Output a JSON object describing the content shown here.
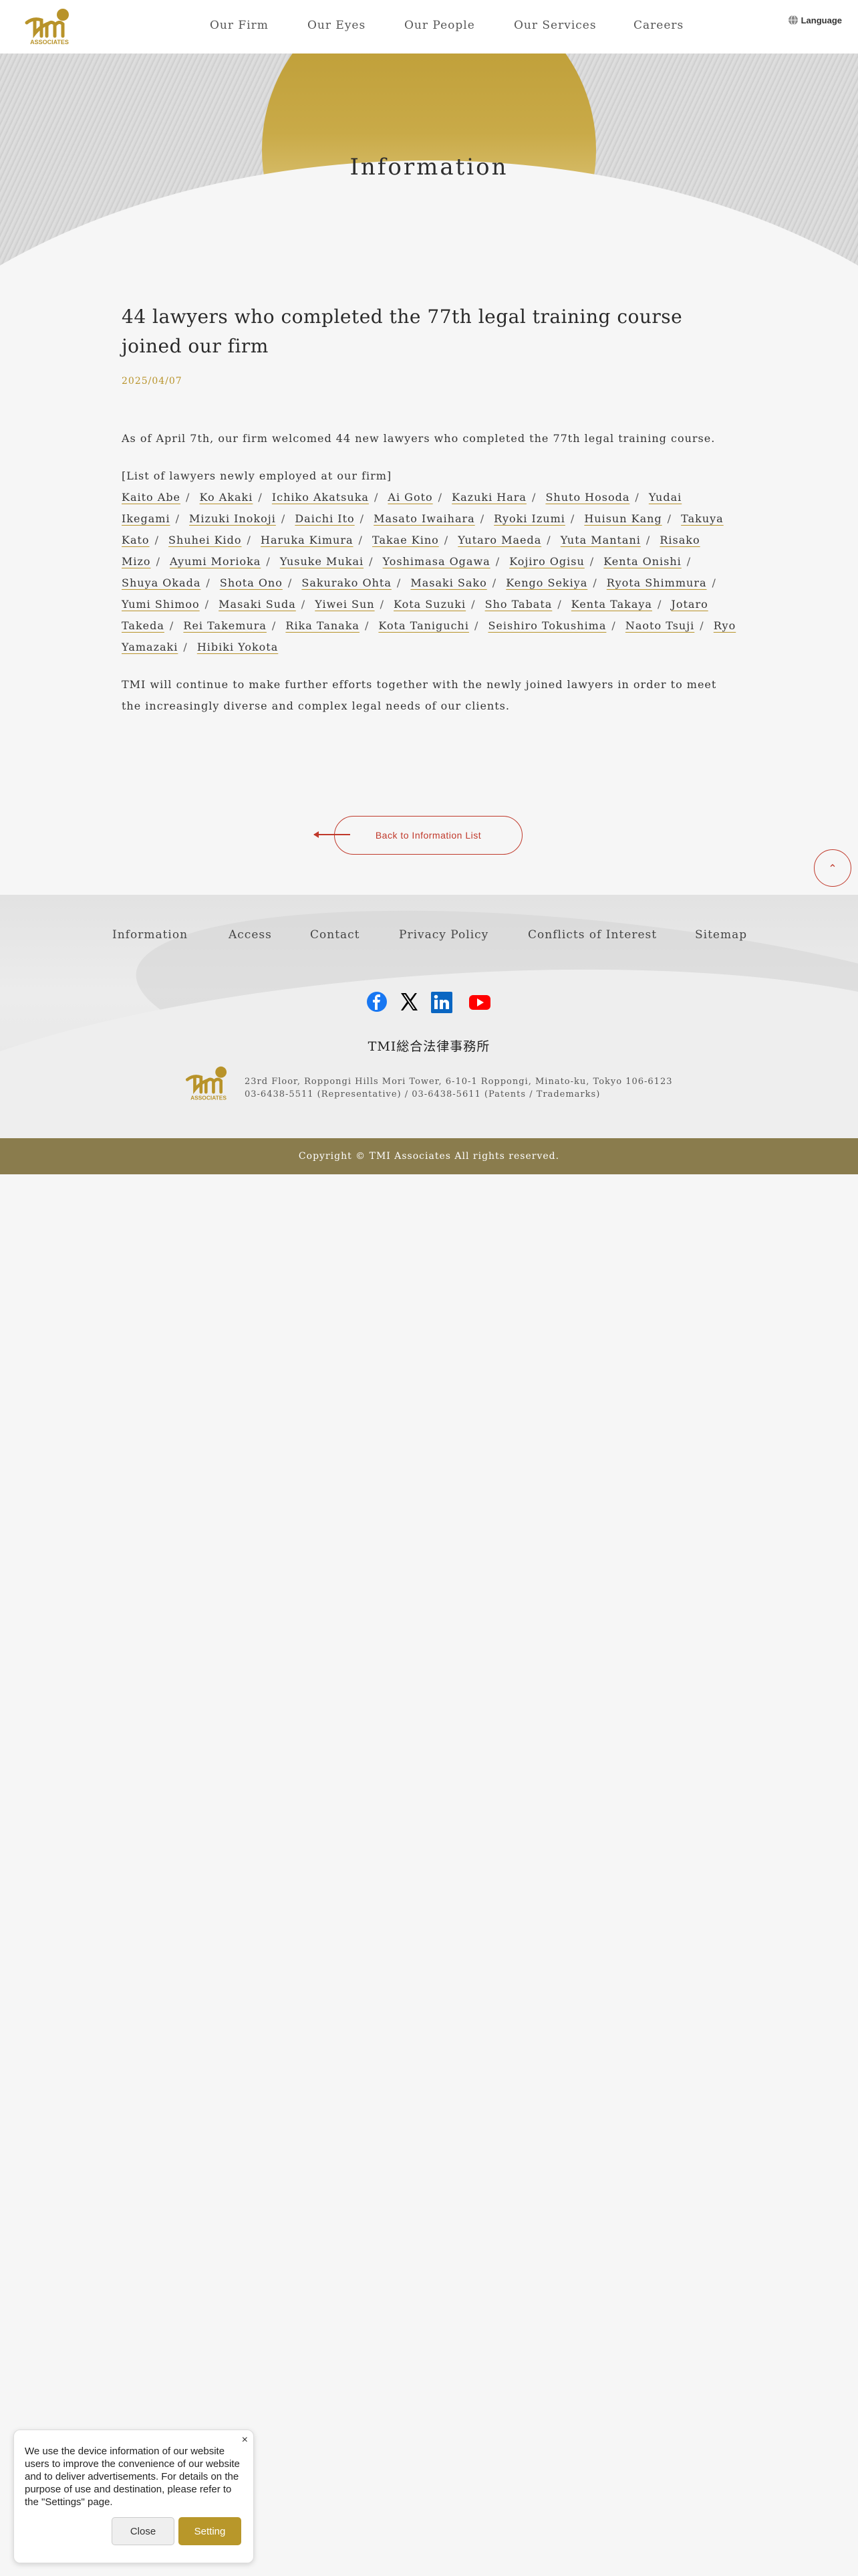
{
  "header": {
    "logo_text": "TMI",
    "logo_sub": "ASSOCIATES",
    "nav": [
      {
        "label": "Our Firm"
      },
      {
        "label": "Our Eyes"
      },
      {
        "label": "Our People"
      },
      {
        "label": "Our Services"
      },
      {
        "label": "Careers"
      }
    ],
    "language_label": "Language"
  },
  "hero": {
    "title": "Information"
  },
  "article": {
    "title": "44 lawyers who completed the 77th legal training course joined our firm",
    "date": "2025/04/07",
    "intro": "As of April 7th, our firm welcomed 44 new lawyers who completed the 77th legal training course.",
    "list_heading": "[List of lawyers newly employed at our firm]",
    "names": [
      "Kaito Abe",
      "Ko Akaki",
      "Ichiko Akatsuka",
      "Ai Goto",
      "Kazuki Hara",
      "Shuto Hosoda",
      "Yudai Ikegami",
      "Mizuki Inokoji",
      "Daichi Ito",
      "Masato Iwaihara",
      "Ryoki Izumi",
      "Huisun Kang",
      "Takuya Kato",
      "Shuhei Kido",
      "Haruka Kimura",
      "Takae Kino",
      "Yutaro Maeda",
      "Yuta Mantani",
      "Risako Mizo",
      "Ayumi Morioka",
      "Yusuke Mukai",
      "Yoshimasa Ogawa",
      "Kojiro Ogisu",
      "Kenta Onishi",
      "Shuya Okada",
      "Shota Ono",
      "Sakurako Ohta",
      "Masaki Sako",
      "Kengo Sekiya",
      "Ryota Shimmura",
      "Yumi Shimoo",
      "Masaki Suda",
      "Yiwei Sun",
      "Kota Suzuki",
      "Sho Tabata",
      "Kenta Takaya",
      "Jotaro Takeda",
      "Rei Takemura",
      "Rika Tanaka",
      "Kota Taniguchi",
      "Seishiro Tokushima",
      "Naoto Tsuji",
      "Ryo Yamazaki",
      "Hibiki Yokota"
    ],
    "closing": "TMI will continue to make further efforts together with the newly joined lawyers in order to meet the increasingly diverse and complex legal needs of our clients.",
    "back_label": "Back to Information List"
  },
  "footer": {
    "nav": [
      {
        "label": "Information"
      },
      {
        "label": "Access"
      },
      {
        "label": "Contact"
      },
      {
        "label": "Privacy Policy"
      },
      {
        "label": "Conflicts of Interest"
      },
      {
        "label": "Sitemap"
      }
    ],
    "social": [
      "facebook-icon",
      "x-icon",
      "linkedin-icon",
      "youtube-icon"
    ],
    "firm_name_jp": "TMI総合法律事務所",
    "address": "23rd Floor, Roppongi Hills Mori Tower, 6-10-1 Roppongi, Minato-ku, Tokyo 106-6123",
    "phones": "03-6438-5511 (Representative) / 03-6438-5611 (Patents / Trademarks)",
    "copyright": "Copyright © TMI Associates All rights reserved."
  },
  "cookie": {
    "text": "We use the device information of our website users to improve the convenience of our website and to deliver advertisements. For details on the purpose of use and destination, please refer to the \"Settings\" page.",
    "close_label": "Close",
    "setting_label": "Setting",
    "close_icon": "×"
  },
  "colors": {
    "gold": "#b8932a",
    "accent_red": "#c0392b",
    "footer_bar": "#8a7c4d"
  }
}
